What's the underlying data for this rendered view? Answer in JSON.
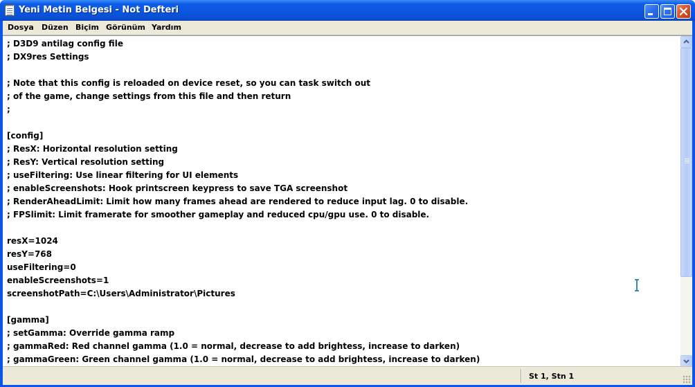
{
  "window": {
    "title": "Yeni Metin Belgesi - Not Defteri",
    "accent": "#0a56e6"
  },
  "menu": {
    "items": [
      {
        "label": "Dosya"
      },
      {
        "label": "Düzen"
      },
      {
        "label": "Biçim"
      },
      {
        "label": "Görünüm"
      },
      {
        "label": "Yardım"
      }
    ]
  },
  "editor": {
    "lines": [
      "; D3D9 antilag config file",
      "; DX9res Settings",
      "",
      "; Note that this config is reloaded on device reset, so you can task switch out",
      "; of the game, change settings from this file and then return",
      ";",
      "",
      "[config]",
      "; ResX: Horizontal resolution setting",
      "; ResY: Vertical resolution setting",
      "; useFiltering: Use linear filtering for UI elements",
      "; enableScreenshots: Hook printscreen keypress to save TGA screenshot",
      "; RenderAheadLimit: Limit how many frames ahead are rendered to reduce input lag. 0 to disable.",
      "; FPSlimit: Limit framerate for smoother gameplay and reduced cpu/gpu use. 0 to disable.",
      "",
      "resX=1024",
      "resY=768",
      "useFiltering=0",
      "enableScreenshots=1",
      "screenshotPath=C:\\Users\\Administrator\\Pictures",
      "",
      "[gamma]",
      "; setGamma: Override gamma ramp",
      "; gammaRed: Red channel gamma (1.0 = normal, decrease to add brightess, increase to darken)",
      "; gammaGreen: Green channel gamma (1.0 = normal, decrease to add brightess, increase to darken)"
    ]
  },
  "status": {
    "position": "St 1, Stn 1"
  }
}
